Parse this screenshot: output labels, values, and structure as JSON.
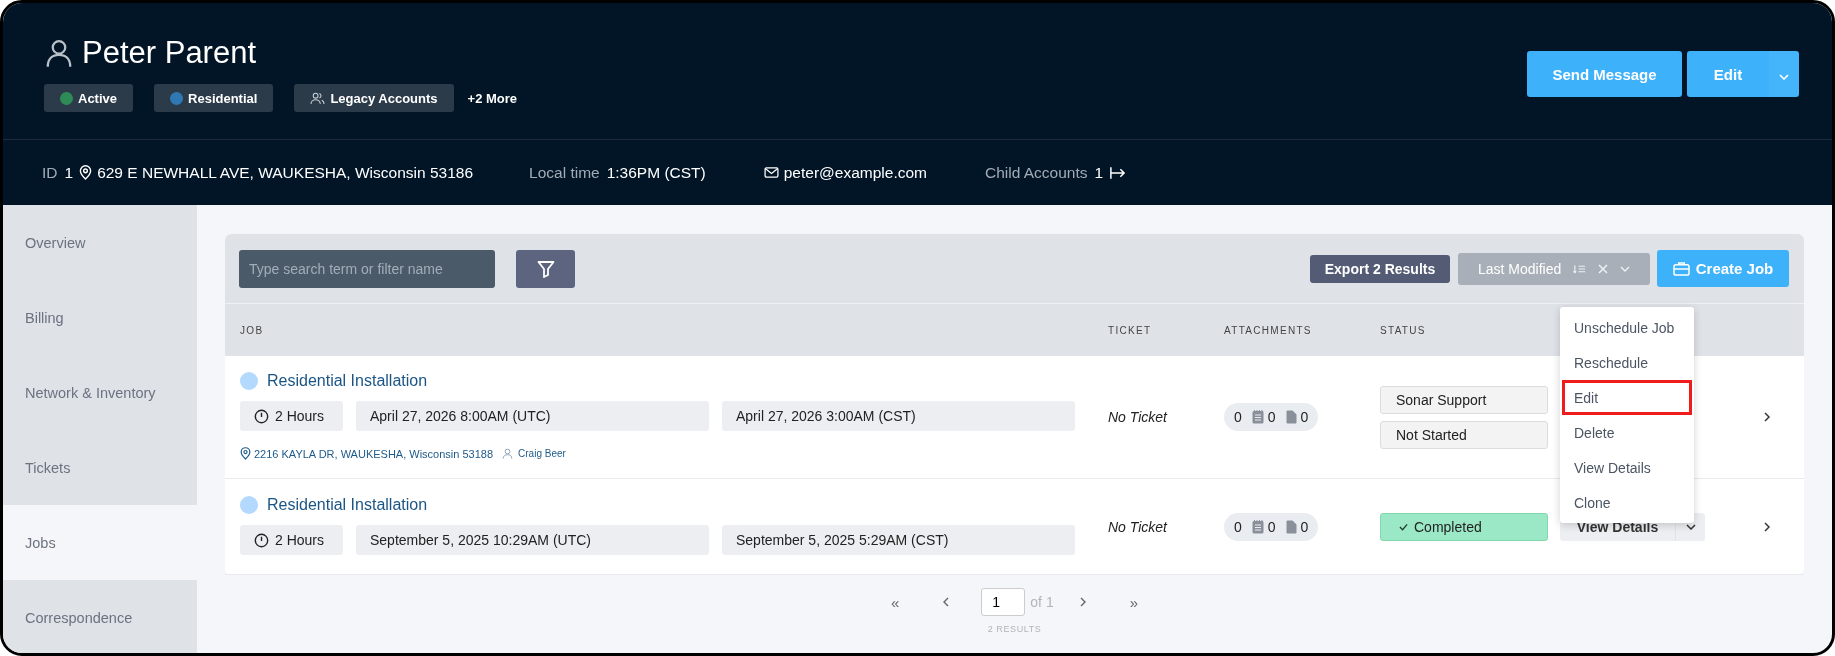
{
  "profile": {
    "name": "Peter Parent",
    "tags": [
      {
        "label": "Active",
        "kind": "dot",
        "color": "#2e8b57"
      },
      {
        "label": "Residential",
        "kind": "dot",
        "color": "#2f78b4"
      },
      {
        "label": "Legacy Accounts",
        "kind": "group"
      }
    ],
    "more": "+2 More"
  },
  "actions": {
    "primary": "Send Message",
    "edit": "Edit"
  },
  "info": {
    "id_label": "ID",
    "id": "1",
    "address": "629 E NEWHALL AVE, WAUKESHA, Wisconsin 53186",
    "time_label": "Local time",
    "time": "1:36PM (CST)",
    "email": "peter@example.com",
    "child_label": "Child Accounts",
    "child": "1"
  },
  "sidebar": {
    "items": [
      {
        "label": "Overview",
        "selected": false
      },
      {
        "label": "Billing",
        "selected": false
      },
      {
        "label": "Network & Inventory",
        "selected": false
      },
      {
        "label": "Tickets",
        "selected": false
      },
      {
        "label": "Jobs",
        "selected": true
      },
      {
        "label": "Correspondence",
        "selected": false
      }
    ]
  },
  "jobs": {
    "search": {
      "placeholder": "Type search term or filter name"
    },
    "export": "Export 2 Results",
    "sort": {
      "label": "Last Modified"
    },
    "create": "Create Job",
    "columns": [
      "JOB",
      "TICKET",
      "ATTACHMENTS",
      "STATUS"
    ],
    "rows": [
      {
        "title": "Residential Installation",
        "color": "#b3d9ff",
        "duration": "2 Hours",
        "start": "April 27, 2026 8:00AM (UTC)",
        "end": "April 27, 2026 3:00AM (CST)",
        "address": "2216 KAYLA DR, WAUKESHA, Wisconsin 53188",
        "person": "Craig Beer",
        "ticket": "No Ticket",
        "attachments": [
          "0",
          "0",
          "0"
        ],
        "statuses": [
          {
            "label": "Sonar Support",
            "kind": "plain"
          },
          {
            "label": "Not Started",
            "kind": "plain"
          }
        ]
      },
      {
        "title": "Residential Installation",
        "color": "#b3d9ff",
        "duration": "2 Hours",
        "start": "September 5, 2025 10:29AM (UTC)",
        "end": "September 5, 2025 5:29AM (CST)",
        "ticket": "No Ticket",
        "attachments": [
          "0",
          "0",
          "0"
        ],
        "statuses": [
          {
            "label": "Completed",
            "kind": "completed"
          }
        ],
        "action": "View Details"
      }
    ],
    "menu": {
      "items": [
        {
          "label": "Unschedule Job",
          "highlighted": false
        },
        {
          "label": "Reschedule",
          "highlighted": false
        },
        {
          "label": "Edit",
          "highlighted": true
        },
        {
          "label": "Delete",
          "highlighted": false
        },
        {
          "label": "View Details",
          "highlighted": false
        },
        {
          "label": "Clone",
          "highlighted": false
        }
      ]
    },
    "pagination": {
      "first": "«",
      "page": "1",
      "of": "of 1",
      "last": "»",
      "results": "2 RESULTS"
    }
  }
}
